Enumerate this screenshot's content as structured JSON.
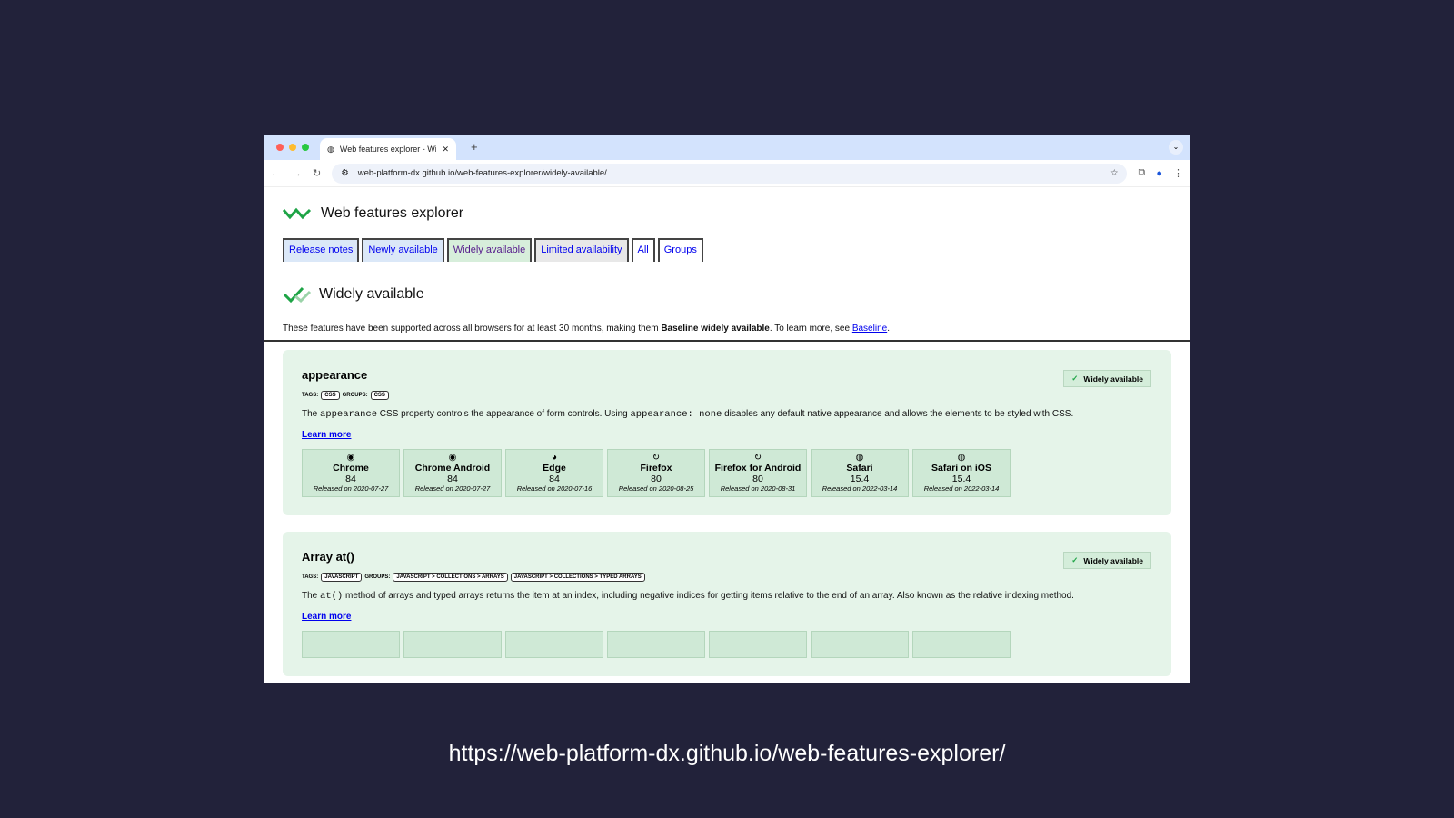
{
  "browser": {
    "tab_title": "Web features explorer - Widely available",
    "url": "web-platform-dx.github.io/web-features-explorer/widely-available/"
  },
  "site": {
    "title": "Web features explorer",
    "nav": [
      "Release notes",
      "Newly available",
      "Widely available",
      "Limited availability",
      "All",
      "Groups"
    ],
    "nav_colors": [
      "#dbe8f8",
      "#dbe8f8",
      "#d7eedb",
      "#e8e8e8",
      "#ffffff",
      "#ffffff"
    ]
  },
  "section": {
    "title": "Widely available",
    "intro_pre": "These features have been supported across all browsers for at least 30 months, making them ",
    "intro_bold": "Baseline widely available",
    "intro_mid": ". To learn more, see ",
    "intro_link": "Baseline",
    "intro_end": "."
  },
  "features": [
    {
      "name": "appearance",
      "badge": "Widely available",
      "tags_label": "TAGS:",
      "tags": [
        "CSS"
      ],
      "groups_label": "GROUPS:",
      "groups": [
        "CSS"
      ],
      "desc": [
        [
          "t",
          "The "
        ],
        [
          "c",
          "appearance"
        ],
        [
          "t",
          " CSS property controls the appearance of form controls. Using "
        ],
        [
          "c",
          "appearance: none"
        ],
        [
          "t",
          " disables any default native appearance and allows the elements to be styled with CSS."
        ]
      ],
      "learn_more": "Learn more",
      "browsers": [
        {
          "name": "Chrome",
          "version": "84",
          "released": "Released on 2020-07-27",
          "icon": "chrome-icon"
        },
        {
          "name": "Chrome Android",
          "version": "84",
          "released": "Released on 2020-07-27",
          "icon": "chrome-icon"
        },
        {
          "name": "Edge",
          "version": "84",
          "released": "Released on 2020-07-16",
          "icon": "edge-icon"
        },
        {
          "name": "Firefox",
          "version": "80",
          "released": "Released on 2020-08-25",
          "icon": "firefox-icon"
        },
        {
          "name": "Firefox for Android",
          "version": "80",
          "released": "Released on 2020-08-31",
          "icon": "firefox-icon"
        },
        {
          "name": "Safari",
          "version": "15.4",
          "released": "Released on 2022-03-14",
          "icon": "safari-icon"
        },
        {
          "name": "Safari on iOS",
          "version": "15.4",
          "released": "Released on 2022-03-14",
          "icon": "safari-icon"
        }
      ]
    },
    {
      "name": "Array at()",
      "badge": "Widely available",
      "tags_label": "TAGS:",
      "tags": [
        "JAVASCRIPT"
      ],
      "groups_label": "GROUPS:",
      "groups": [
        "JAVASCRIPT > COLLECTIONS > ARRAYS",
        "JAVASCRIPT > COLLECTIONS > TYPED ARRAYS"
      ],
      "desc": [
        [
          "t",
          "The "
        ],
        [
          "c",
          "at()"
        ],
        [
          "t",
          " method of arrays and typed arrays returns the item at an index, including negative indices for getting items relative to the end of an array. Also known as the relative indexing method."
        ]
      ],
      "learn_more": "Learn more",
      "browsers": []
    }
  ],
  "caption": "https://web-platform-dx.github.io/web-features-explorer/"
}
